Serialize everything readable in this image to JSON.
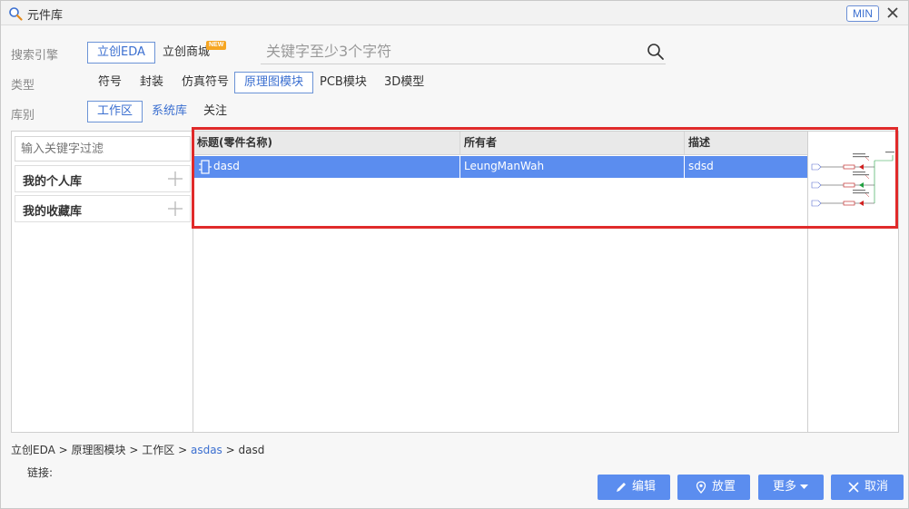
{
  "window": {
    "title": "元件库",
    "min_label": "MIN"
  },
  "search_engine": {
    "label": "搜索引擎",
    "options": [
      "立创EDA",
      "立创商城"
    ],
    "new_badge": "NEW",
    "placeholder": "关键字至少3个字符"
  },
  "type_row": {
    "label": "类型",
    "options": [
      "符号",
      "封装",
      "仿真符号",
      "原理图模块",
      "PCB模块",
      "3D模型"
    ]
  },
  "library_row": {
    "label": "库别",
    "options": [
      "工作区",
      "系统库",
      "关注"
    ]
  },
  "left_pane": {
    "filter_placeholder": "输入关键字过滤",
    "groups": [
      "我的个人库",
      "我的收藏库"
    ]
  },
  "table": {
    "columns": [
      "标题(零件名称)",
      "所有者",
      "描述"
    ],
    "rows": [
      {
        "title": "dasd",
        "owner": "LeungManWah",
        "description": "sdsd"
      }
    ]
  },
  "breadcrumb": {
    "items": [
      "立创EDA",
      "原理图模块",
      "工作区",
      "asdas",
      "dasd"
    ],
    "separator": ">"
  },
  "link_label": "链接:",
  "buttons": {
    "edit": "编辑",
    "place": "放置",
    "more": "更多",
    "cancel": "取消"
  },
  "colors": {
    "accent": "#5b8def",
    "highlight": "#e02a2a",
    "link": "#3b6fd0"
  }
}
